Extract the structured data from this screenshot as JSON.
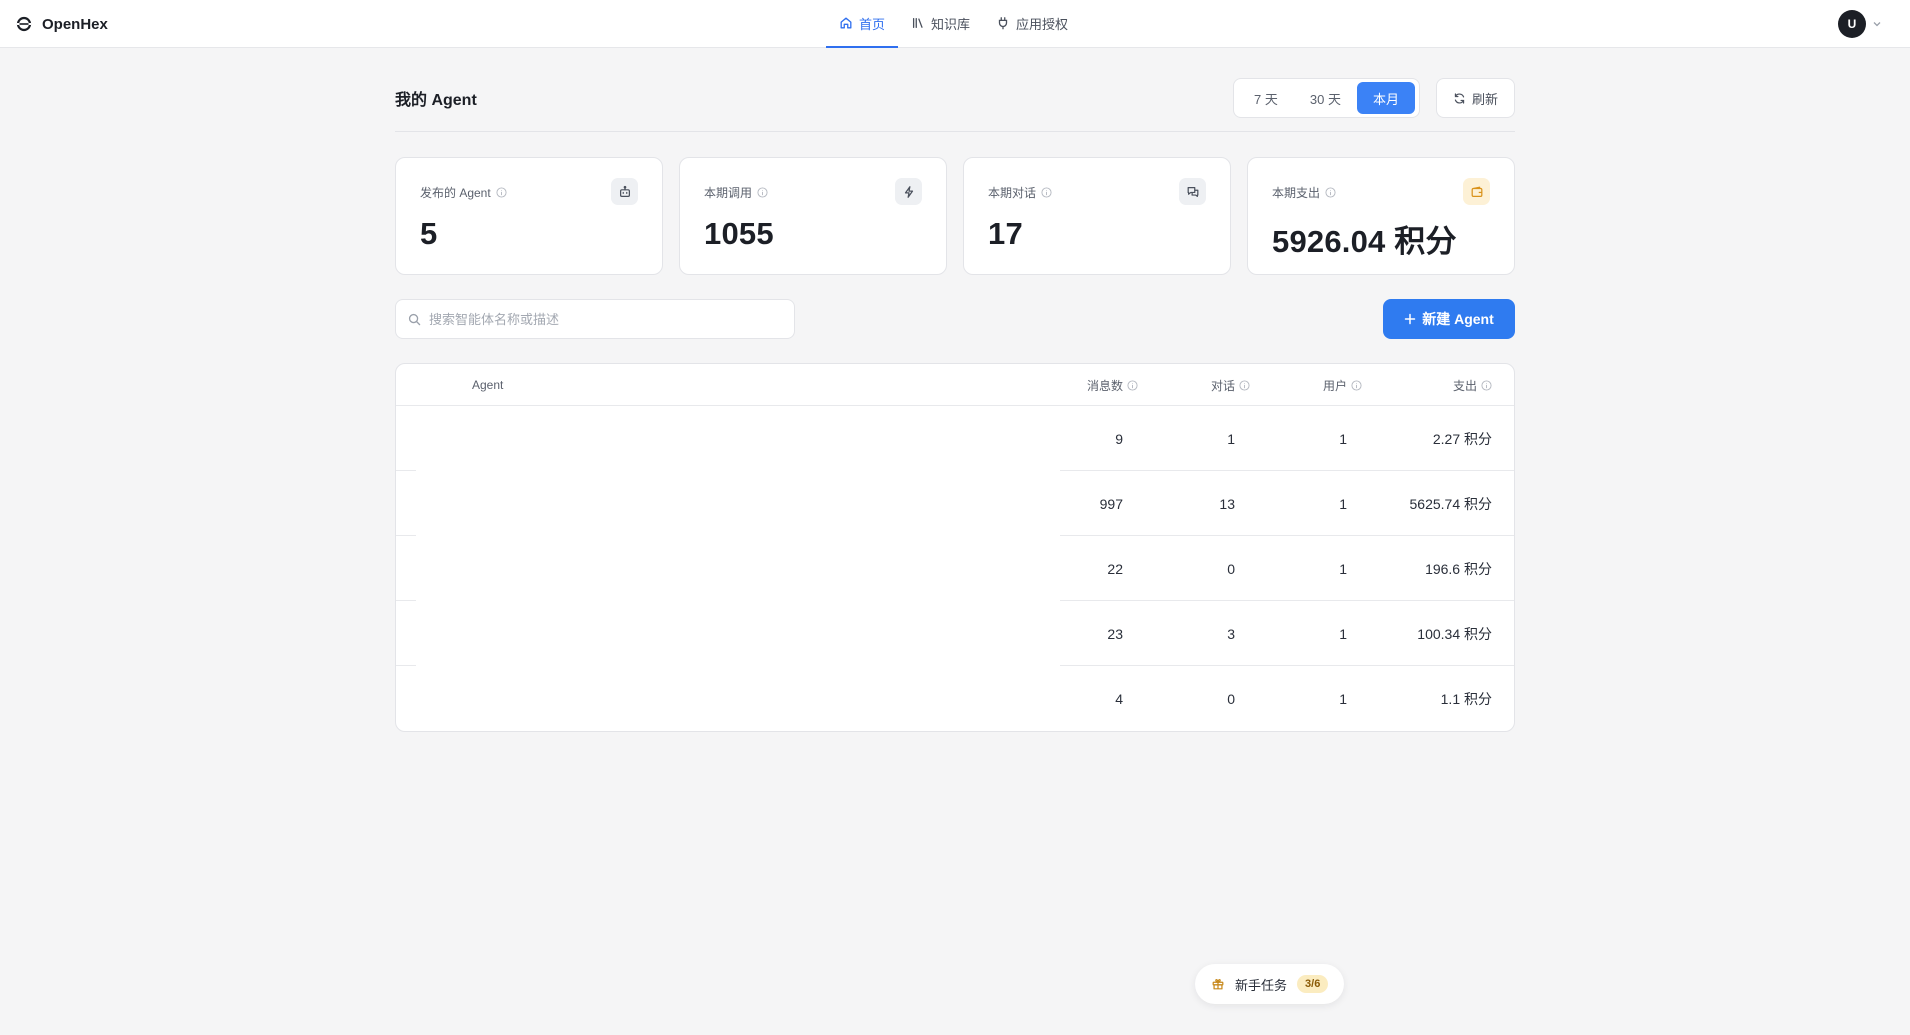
{
  "app": {
    "name": "OpenHex",
    "user_initial": "U"
  },
  "nav": {
    "items": [
      {
        "label": "首页",
        "icon": "home-icon",
        "active": true
      },
      {
        "label": "知识库",
        "icon": "library-icon",
        "active": false
      },
      {
        "label": "应用授权",
        "icon": "plug-icon",
        "active": false
      }
    ]
  },
  "page": {
    "title": "我的 Agent",
    "range_options": [
      "7 天",
      "30 天",
      "本月"
    ],
    "range_selected": "本月",
    "refresh_label": "刷新"
  },
  "stats": [
    {
      "label": "发布的 Agent",
      "value": "5",
      "icon": "bot-icon"
    },
    {
      "label": "本期调用",
      "value": "1055",
      "icon": "bolt-icon"
    },
    {
      "label": "本期对话",
      "value": "17",
      "icon": "chat-icon"
    },
    {
      "label": "本期支出",
      "value": "5926.04 积分",
      "icon": "wallet-icon"
    }
  ],
  "search": {
    "placeholder": "搜索智能体名称或描述",
    "value": ""
  },
  "new_agent_label": "新建 Agent",
  "table": {
    "columns": {
      "agent": "Agent",
      "messages": "消息数",
      "conversations": "对话",
      "users": "用户",
      "cost": "支出"
    },
    "rows": [
      {
        "messages": "9",
        "conversations": "1",
        "users": "1",
        "cost": "2.27 积分"
      },
      {
        "messages": "997",
        "conversations": "13",
        "users": "1",
        "cost": "5625.74 积分"
      },
      {
        "messages": "22",
        "conversations": "0",
        "users": "1",
        "cost": "196.6 积分"
      },
      {
        "messages": "23",
        "conversations": "3",
        "users": "1",
        "cost": "100.34 积分"
      },
      {
        "messages": "4",
        "conversations": "0",
        "users": "1",
        "cost": "1.1 积分"
      }
    ]
  },
  "onboarding": {
    "label": "新手任务",
    "progress": "3/6"
  },
  "colors": {
    "primary": "#2f7bf0",
    "nav_active": "#2f6fef",
    "accent_warm": "#d9921a"
  }
}
